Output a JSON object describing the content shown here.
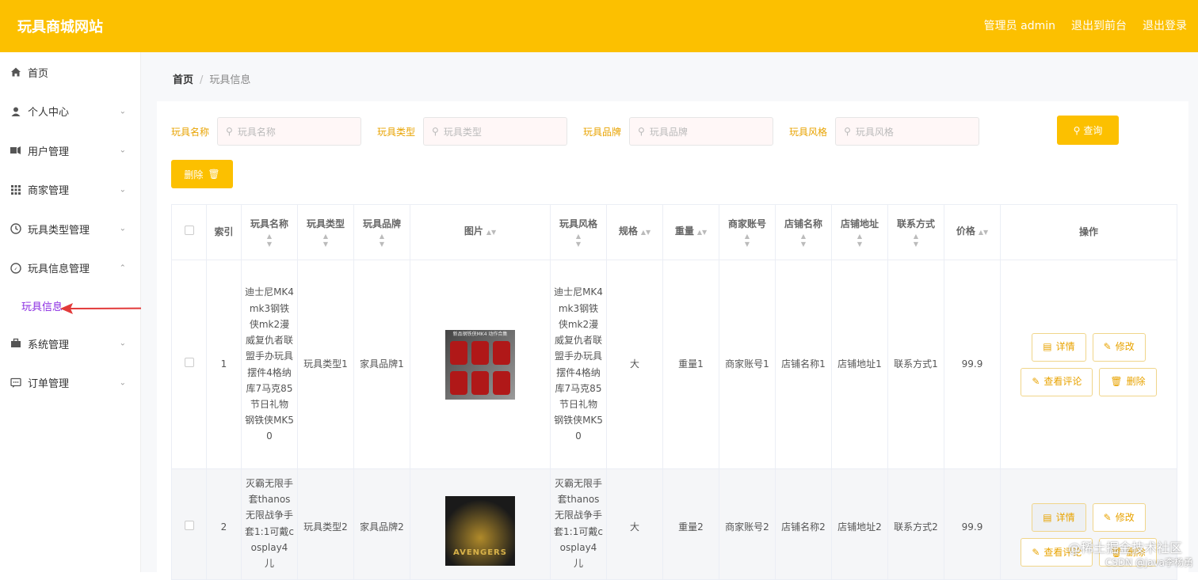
{
  "header": {
    "brand": "玩具商城网站",
    "admin": "管理员 admin",
    "to_front": "退出到前台",
    "logout": "退出登录"
  },
  "sidebar": {
    "items": [
      {
        "label": "首页",
        "icon": "home-icon",
        "arrow": ""
      },
      {
        "label": "个人中心",
        "icon": "user-icon",
        "arrow": "⌄"
      },
      {
        "label": "用户管理",
        "icon": "users-icon",
        "arrow": "⌄"
      },
      {
        "label": "商家管理",
        "icon": "grid-icon",
        "arrow": "⌄"
      },
      {
        "label": "玩具类型管理",
        "icon": "clock-icon",
        "arrow": "⌄"
      },
      {
        "label": "玩具信息管理",
        "icon": "compass-icon",
        "arrow": "⌃"
      },
      {
        "label": "系统管理",
        "icon": "toolbox-icon",
        "arrow": "⌄"
      },
      {
        "label": "订单管理",
        "icon": "chat-icon",
        "arrow": "⌄"
      }
    ],
    "sub_active": "玩具信息"
  },
  "breadcrumb": {
    "home": "首页",
    "sep": "/",
    "current": "玩具信息"
  },
  "search": {
    "name_label": "玩具名称",
    "name_ph": "玩具名称",
    "type_label": "玩具类型",
    "type_ph": "玩具类型",
    "brand_label": "玩具品牌",
    "brand_ph": "玩具品牌",
    "style_label": "玩具风格",
    "style_ph": "玩具风格",
    "query": "查询",
    "delete": "删除"
  },
  "table": {
    "headers": [
      "索引",
      "玩具名称",
      "玩具类型",
      "玩具品牌",
      "图片",
      "玩具风格",
      "规格",
      "重量",
      "商家账号",
      "店铺名称",
      "店铺地址",
      "联系方式",
      "价格",
      "操作"
    ],
    "rows": [
      {
        "index": "1",
        "name": "迪士尼MK4mk3钢铁侠mk2漫威复仇者联盟手办玩具摆件4格纳库7马克85节日礼物 钢铁侠MK50",
        "type": "玩具类型1",
        "brand": "家具品牌1",
        "img_title": "新品钢铁侠MK4 动作合集",
        "style": "迪士尼MK4mk3钢铁侠mk2漫威复仇者联盟手办玩具摆件4格纳库7马克85节日礼物 钢铁侠MK50",
        "spec": "大",
        "weight": "重量1",
        "merchant": "商家账号1",
        "shop": "店铺名称1",
        "addr": "店铺地址1",
        "contact": "联系方式1",
        "price": "99.9"
      },
      {
        "index": "2",
        "name": "灭霸无限手套thanos无限战争手套1:1可戴cosplay4 儿",
        "type": "玩具类型2",
        "brand": "家具品牌2",
        "img_title": "AVENGERS",
        "style": "灭霸无限手套thanos无限战争手套1:1可戴cosplay4 儿",
        "spec": "大",
        "weight": "重量2",
        "merchant": "商家账号2",
        "shop": "店铺名称2",
        "addr": "店铺地址2",
        "contact": "联系方式2",
        "price": "99.9"
      }
    ],
    "ops": {
      "detail": "详情",
      "edit": "修改",
      "review": "查看评论",
      "del": "删除"
    }
  },
  "watermark": "@稀土掘金技术社区",
  "watermark2": "CSDN @java李杨勇",
  "colors": {
    "accent": "#fcc000",
    "active_sub": "#8a2be2",
    "arrow": "#e23a3a"
  }
}
